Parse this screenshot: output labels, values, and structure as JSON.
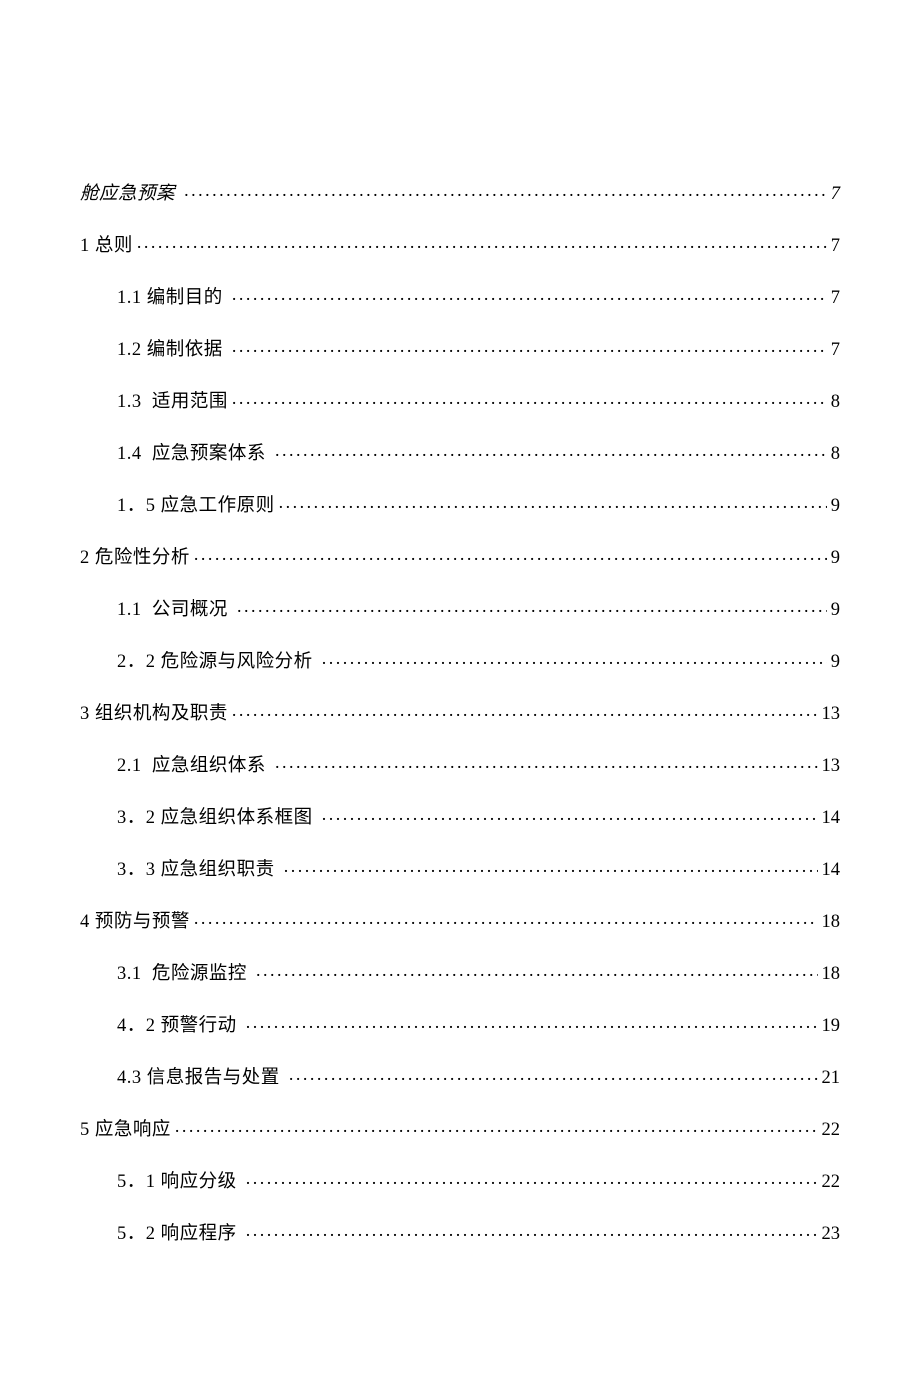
{
  "toc": [
    {
      "level": 1,
      "title": "舱应急预案 ",
      "page": " 7",
      "italic": true
    },
    {
      "level": 1,
      "title": "1 总则",
      "page": " 7",
      "italic": false
    },
    {
      "level": 2,
      "title": "1.1 编制目的 ",
      "page": " 7",
      "italic": false
    },
    {
      "level": 2,
      "title": "1.2 编制依据 ",
      "page": " 7",
      "italic": false
    },
    {
      "level": 2,
      "title": "1.3  适用范围",
      "page": " 8",
      "italic": false
    },
    {
      "level": 2,
      "title": "1.4  应急预案体系 ",
      "page": " 8",
      "italic": false
    },
    {
      "level": 2,
      "title": "1．5 应急工作原则",
      "page": " 9",
      "italic": false
    },
    {
      "level": 1,
      "title": "2 危险性分析",
      "page": " 9",
      "italic": false
    },
    {
      "level": 2,
      "title": "1.1  公司概况 ",
      "page": " 9",
      "italic": false
    },
    {
      "level": 2,
      "title": "2．2 危险源与风险分析 ",
      "page": " 9",
      "italic": false
    },
    {
      "level": 1,
      "title": "3 组织机构及职责",
      "page": " 13",
      "italic": false
    },
    {
      "level": 2,
      "title": "2.1  应急组织体系 ",
      "page": " 13",
      "italic": false
    },
    {
      "level": 2,
      "title": "3．2 应急组织体系框图 ",
      "page": " 14",
      "italic": false
    },
    {
      "level": 2,
      "title": "3．3 应急组织职责 ",
      "page": " 14",
      "italic": false
    },
    {
      "level": 1,
      "title": "4 预防与预警",
      "page": " 18",
      "italic": false
    },
    {
      "level": 2,
      "title": "3.1  危险源监控 ",
      "page": " 18",
      "italic": false
    },
    {
      "level": 2,
      "title": "4．2 预警行动 ",
      "page": " 19",
      "italic": false
    },
    {
      "level": 2,
      "title": "4.3 信息报告与处置 ",
      "page": " 21",
      "italic": false
    },
    {
      "level": 1,
      "title": "5 应急响应",
      "page": " 22",
      "italic": false
    },
    {
      "level": 2,
      "title": "5．1 响应分级 ",
      "page": " 22",
      "italic": false
    },
    {
      "level": 2,
      "title": "5．2 响应程序 ",
      "page": " 23",
      "italic": false
    }
  ]
}
